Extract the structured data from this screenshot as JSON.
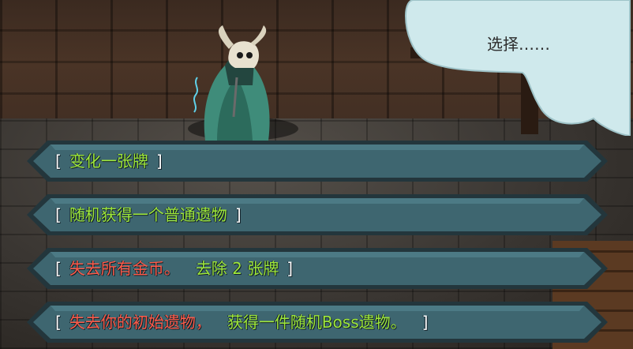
{
  "dialog": {
    "prompt": "选择……"
  },
  "options": [
    {
      "open": "[",
      "parts": [
        {
          "text": "变化一张牌",
          "tone": "good"
        }
      ],
      "close": "]"
    },
    {
      "open": "[",
      "parts": [
        {
          "text": "随机获得一个普通遗物",
          "tone": "good"
        }
      ],
      "close": "]"
    },
    {
      "open": "[",
      "parts": [
        {
          "text": "失去所有金币。",
          "tone": "bad"
        },
        {
          "text": "去除 2 张牌",
          "tone": "good"
        }
      ],
      "close": "]"
    },
    {
      "open": "[",
      "parts": [
        {
          "text": "失去你的初始遗物，",
          "tone": "bad"
        },
        {
          "text": "获得一件随机Boss遗物。",
          "tone": "good"
        }
      ],
      "close": "]"
    }
  ],
  "colors": {
    "good": "#9fe83a",
    "bad": "#ff5b4a",
    "button_fill": "#3e6670",
    "button_edge": "#23363c",
    "bubble": "#cfe9ec"
  },
  "icons": {
    "npc": "ram-skull-cloaked-figure-icon"
  }
}
